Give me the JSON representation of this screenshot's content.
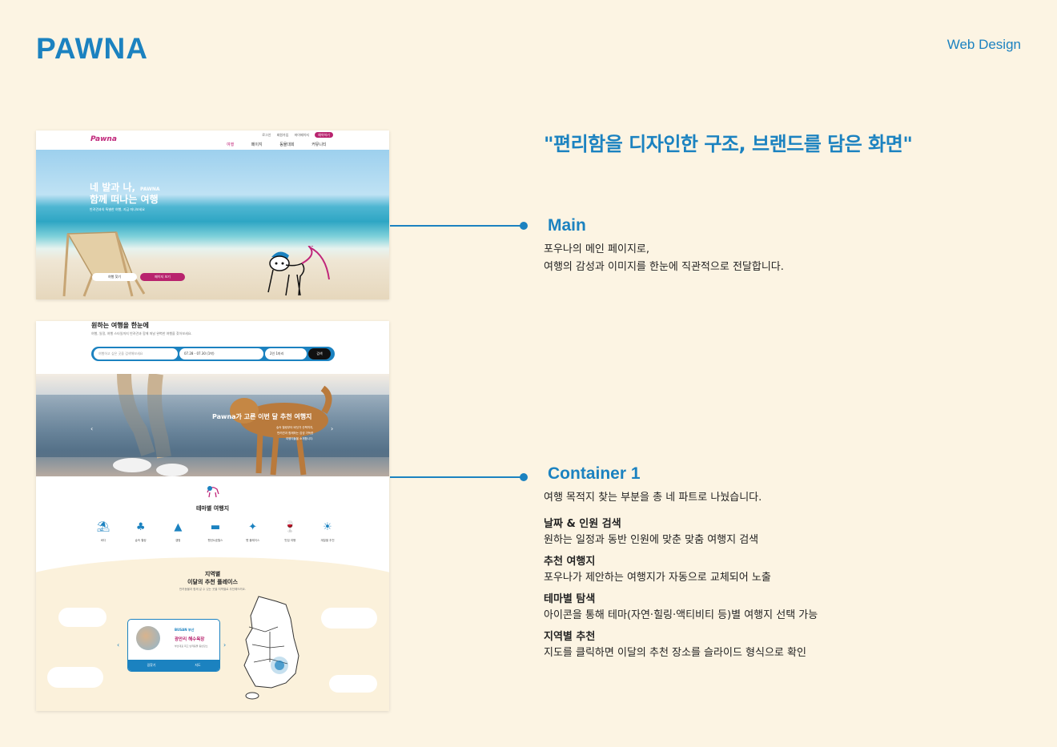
{
  "header": {
    "brand": "PAWNA",
    "tag": "Web Design"
  },
  "headline": "\"편리함을 디자인한 구조, 브랜드를 담은 화면\"",
  "sections": [
    {
      "title": "Main",
      "lines": [
        "포우나의 메인 페이지로,",
        "여행의 감성과 이미지를 한눈에 직관적으로 전달합니다."
      ]
    },
    {
      "title": "Container 1",
      "intro": "여행 목적지 찾는 부분을 총 네 파트로 나눴습니다.",
      "features": [
        {
          "name": "날짜 & 인원 검색",
          "desc": "원하는 일정과 동반 인원에 맞춘 맞춤 여행지 검색"
        },
        {
          "name": "추천 여행지",
          "desc": "포우나가 제안하는 여행지가 자동으로 교체되어 노출"
        },
        {
          "name": "테마별 탐색",
          "desc": "아이콘을 통해 테마(자연·힐링·액티비티 등)별 여행지 선택 가능"
        },
        {
          "name": "지역별 추천",
          "desc": "지도를 클릭하면 이달의 추천 장소를 슬라이드 형식으로 확인"
        }
      ]
    }
  ],
  "mock_main": {
    "logo": "Pawna",
    "menu": [
      "여행",
      "페이지",
      "동물대회",
      "커뮤니티"
    ],
    "util": [
      "로그인",
      "회원가입",
      "마이페이지"
    ],
    "util_pill": "예약하기",
    "hero_line1": "네 발과 나,",
    "hero_line2": "함께 떠나는 여행",
    "hero_brand": "PAWNA",
    "hero_sub": "반려견과의 특별한 여행, 지금 떠나보세요",
    "btn_primary": "여행 찾기",
    "btn_secondary": "페이지 보기"
  },
  "mock_container": {
    "search_title": "원하는 여행을 한눈에",
    "search_sub": "여행, 일정, 여행 스타일까지 반려견과 함께 떠날 완벽한 여행을 찾아보세요.",
    "search_placeholder": "여행하고 싶은 곳을 검색해보세요",
    "date": "07.28 - 07.30 (1박)",
    "people": "2인 1마리",
    "search_btn": "검색",
    "reco_title": "Pawna가 고른 이번 달 추천 여행지",
    "reco_desc": [
      "숲속 힐링부터 바닷가 산책까지,",
      "반려견과 함께하는 감성 가득한",
      "여행지들을 소개합니다."
    ],
    "theme_title": "테마별 여행지",
    "themes": [
      {
        "icon": "beach-icon",
        "label": "바다"
      },
      {
        "icon": "forest-icon",
        "label": "숲속 힐링"
      },
      {
        "icon": "camping-icon",
        "label": "캠핑"
      },
      {
        "icon": "pension-icon",
        "label": "펜션&호텔스"
      },
      {
        "icon": "pet-place-icon",
        "label": "펫 플레이스"
      },
      {
        "icon": "restaurant-icon",
        "label": "맛집 여행"
      },
      {
        "icon": "season-icon",
        "label": "계절별 추천"
      }
    ],
    "region_title_1": "지역별",
    "region_title_2": "이달의 추천 플레이스",
    "region_sub": "반려동물과 함께 갈 수 있는 곳을 지역별로 추천해드려요.",
    "card_region": "BUSAN 부산",
    "card_name": "광안리 해수욕장",
    "card_desc": "부산대표 최고 반려동물 동반장소",
    "card_btn_left": "길찾기",
    "card_btn_right": "지도"
  }
}
